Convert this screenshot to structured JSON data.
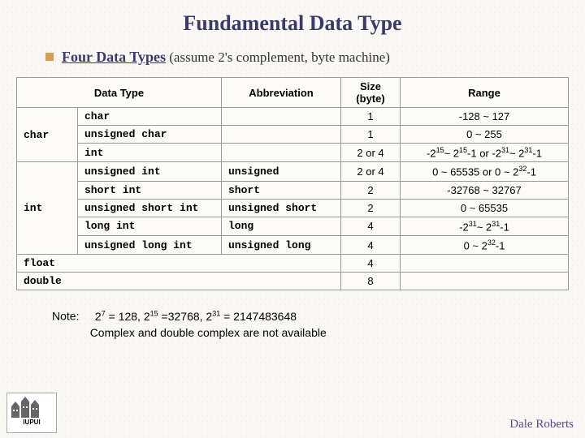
{
  "title": "Fundamental Data Type",
  "subtitle_b": "Four Data Types",
  "subtitle_rest": " (assume 2's complement, byte machine)",
  "headers": {
    "dt": "Data Type",
    "ab": "Abbreviation",
    "sz": "Size (byte)",
    "rg": "Range"
  },
  "r": [
    {
      "g": "char",
      "t": "char",
      "a": "",
      "s": "1",
      "rg": "-128 ~ 127"
    },
    {
      "g": "",
      "t": "unsigned char",
      "a": "",
      "s": "1",
      "rg": "0 ~ 255"
    },
    {
      "g": "",
      "t": "int",
      "a": "",
      "s": "2 or 4",
      "rg": "-2<sup>15</sup>~ 2<sup>15</sup>-1 or -2<sup>31</sup>~ 2<sup>31</sup>-1"
    },
    {
      "g": "int",
      "t": "unsigned int",
      "a": "unsigned",
      "s": "2 or 4",
      "rg": "0 ~ 65535 or 0 ~ 2<sup>32</sup>-1"
    },
    {
      "g": "",
      "t": "short int",
      "a": "short",
      "s": "2",
      "rg": "-32768 ~ 32767"
    },
    {
      "g": "",
      "t": "unsigned short int",
      "a": "unsigned short",
      "s": "2",
      "rg": "0 ~ 65535"
    },
    {
      "g": "",
      "t": "long int",
      "a": "long",
      "s": "4",
      "rg": "-2<sup>31</sup>~ 2<sup>31</sup>-1"
    },
    {
      "g": "",
      "t": "unsigned long int",
      "a": "unsigned long",
      "s": "4",
      "rg": "0 ~ 2<sup>32</sup>-1"
    },
    {
      "g": "float",
      "t": "",
      "a": "",
      "s": "4",
      "rg": ""
    },
    {
      "g": "double",
      "t": "",
      "a": "",
      "s": "8",
      "rg": ""
    }
  ],
  "note_label": "Note:",
  "note_line1": "2<sup>7</sup> = 128, 2<sup>15</sup> =32768, 2<sup>31</sup> = 2147483648",
  "note_line2": "Complex and double complex are not available",
  "author": "Dale Roberts",
  "logo": "IUPUI",
  "chart_data": {
    "type": "table",
    "title": "Fundamental Data Type",
    "columns": [
      "Data Type",
      "",
      "Abbreviation",
      "Size (byte)",
      "Range"
    ],
    "rows": [
      [
        "char",
        "char",
        "",
        "1",
        "-128 ~ 127"
      ],
      [
        "",
        "unsigned char",
        "",
        "1",
        "0 ~ 255"
      ],
      [
        "",
        "int",
        "",
        "2 or 4",
        "-2^15 ~ 2^15-1 or -2^31 ~ 2^31-1"
      ],
      [
        "int",
        "unsigned int",
        "unsigned",
        "2 or 4",
        "0 ~ 65535 or 0 ~ 2^32-1"
      ],
      [
        "",
        "short int",
        "short",
        "2",
        "-32768 ~ 32767"
      ],
      [
        "",
        "unsigned short int",
        "unsigned short",
        "2",
        "0 ~ 65535"
      ],
      [
        "",
        "long int",
        "long",
        "4",
        "-2^31 ~ 2^31-1"
      ],
      [
        "",
        "unsigned long int",
        "unsigned long",
        "4",
        "0 ~ 2^32-1"
      ],
      [
        "float",
        "",
        "",
        "4",
        ""
      ],
      [
        "double",
        "",
        "",
        "8",
        ""
      ]
    ]
  }
}
